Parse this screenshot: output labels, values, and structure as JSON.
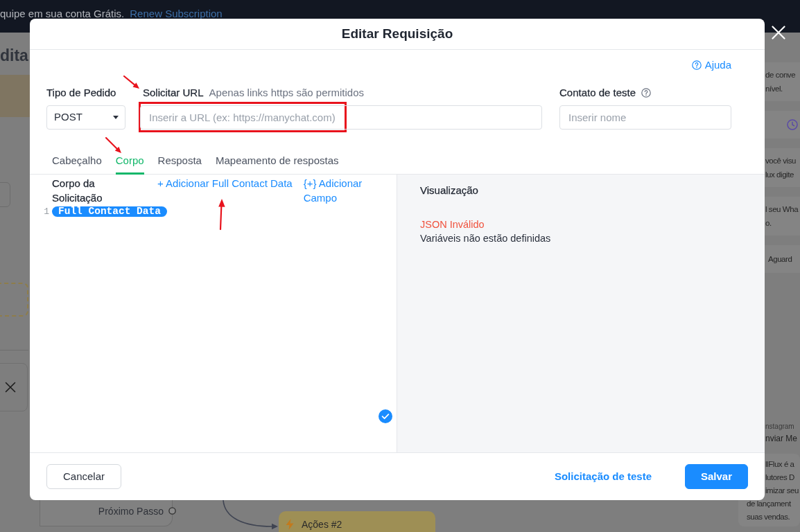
{
  "banner": {
    "message": "quipe em sua conta Grátis.",
    "link": "Renew Subscription"
  },
  "page_heading": "dita",
  "flow_canvas": {
    "output_label": "Próximo Passo",
    "next_node": {
      "title": "Ações #2"
    }
  },
  "side_panel": {
    "cards": [
      {
        "kind": "text",
        "lines": [
          "de conve",
          "nível."
        ]
      },
      {
        "kind": "timer"
      },
      {
        "kind": "text",
        "lines": [
          "você visu",
          "lux digite"
        ]
      },
      {
        "kind": "text",
        "lines": [
          "l seu Wha",
          "o."
        ]
      },
      {
        "kind": "text",
        "lines": [
          "Aguard"
        ]
      }
    ],
    "message_step": {
      "channel": "nstagram",
      "title": "nviar Me",
      "lines": [
        "llFlux é a",
        "lutores D",
        "imizar seu",
        "de lançament",
        "suas vendas."
      ]
    }
  },
  "dialog": {
    "title": "Editar Requisição",
    "help_link": "Ajuda",
    "method": {
      "label": "Tipo de Pedido",
      "value": "POST"
    },
    "url": {
      "label": "Solicitar URL",
      "hint": "Apenas links https são permitidos",
      "placeholder": "Inserir a URL (ex: https://manychat.com)",
      "marked": true,
      "highlighted": true
    },
    "test_contact": {
      "label": "Contato de teste",
      "placeholder": "Inserir nome"
    },
    "tabs": [
      {
        "label": "Cabeçalho",
        "selected": false,
        "marked": false
      },
      {
        "label": "Corpo",
        "selected": true,
        "marked": true
      },
      {
        "label": "Resposta",
        "selected": false,
        "marked": false
      },
      {
        "label": "Mapeamento de respostas",
        "selected": false,
        "marked": false
      }
    ],
    "body_editor": {
      "title": "Corpo da Solicitação",
      "actions": [
        {
          "label": "+ Adicionar Full Contact Data",
          "marked": true
        },
        {
          "label": "{+} Adicionar Campo",
          "marked": false
        }
      ],
      "lines": [
        {
          "number": "1",
          "tokens": [
            {
              "kind": "variable",
              "text": "Full Contact Data"
            }
          ]
        }
      ]
    },
    "preview": {
      "title": "Visualização",
      "error": "JSON Inválido",
      "message": "Variáveis não estão definidas"
    },
    "buttons": {
      "cancel": "Cancelar",
      "test": "Solicitação de teste",
      "save": "Salvar"
    }
  }
}
